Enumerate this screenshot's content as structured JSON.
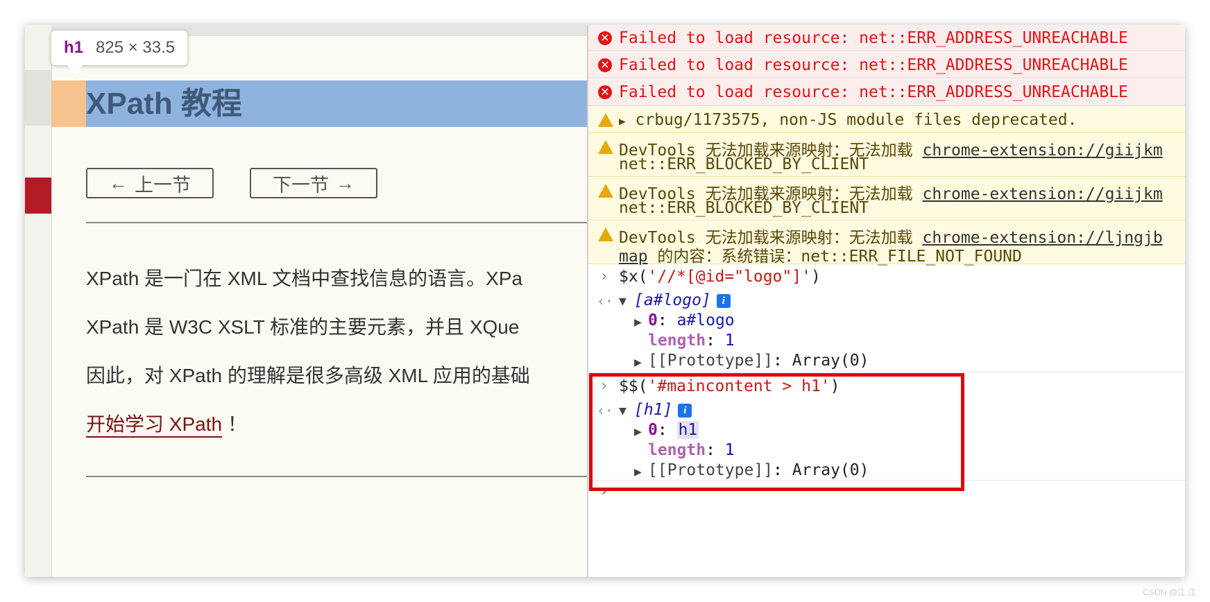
{
  "tooltip": {
    "tag": "h1",
    "dims": "825 × 33.5"
  },
  "page": {
    "heading": "XPath 教程",
    "nav": {
      "prev_icon": "←",
      "prev": "上一节",
      "next": "下一节",
      "next_icon": "→"
    },
    "paragraphs": [
      "XPath 是一门在 XML 文档中查找信息的语言。XPa",
      "XPath 是 W3C XSLT 标准的主要元素，并且 XQue",
      "因此，对 XPath 的理解是很多高级 XML 应用的基础"
    ],
    "start_link": "开始学习 XPath",
    "start_suffix": "！"
  },
  "console": {
    "errors": [
      "Failed to load resource: net::ERR_ADDRESS_UNREACHABLE",
      "Failed to load resource: net::ERR_ADDRESS_UNREACHABLE",
      "Failed to load resource: net::ERR_ADDRESS_UNREACHABLE"
    ],
    "warning_crbug": "crbug/1173575, non-JS module files deprecated.",
    "devtools_warnings": [
      {
        "prefix": "DevTools 无法加载来源映射：无法加载 ",
        "link": "chrome-extension://giijkm",
        "line2_link": "",
        "line2": "net::ERR_BLOCKED_BY_CLIENT"
      },
      {
        "prefix": "DevTools 无法加载来源映射：无法加载 ",
        "link": "chrome-extension://giijkm",
        "line2_link": "",
        "line2": "net::ERR_BLOCKED_BY_CLIENT"
      },
      {
        "prefix": "DevTools 无法加载来源映射：无法加载 ",
        "link": "chrome-extension://ljngjb",
        "line2_link": "map",
        "line2": " 的内容：系统错误：net::ERR_FILE_NOT_FOUND"
      }
    ],
    "cmd1": {
      "fn": "$x(",
      "arg": "'//*[@id=\"logo\"]'",
      "close": ")"
    },
    "result1": {
      "label": "[a#logo]",
      "item_key": "0",
      "item_val": "a#logo",
      "length_key": "length",
      "length_val": "1",
      "proto": "[[Prototype]]",
      "proto_val": "Array(0)"
    },
    "cmd2": {
      "fn": "$$(",
      "arg": "'#maincontent > h1'",
      "close": ")"
    },
    "result2": {
      "label": "[h1]",
      "item_key": "0",
      "item_val": "h1",
      "length_key": "length",
      "length_val": "1",
      "proto": "[[Prototype]]",
      "proto_val": "Array(0)"
    },
    "info_badge": "i",
    "prompt_char": "›",
    "return_char": "‹·"
  },
  "watermark": "CSDN @江.江",
  "colors": {
    "error": "#e31313",
    "warning_icon": "#e5a80d",
    "highlight_box": "#e0060d",
    "heading_highlight": "#8fb3df"
  }
}
